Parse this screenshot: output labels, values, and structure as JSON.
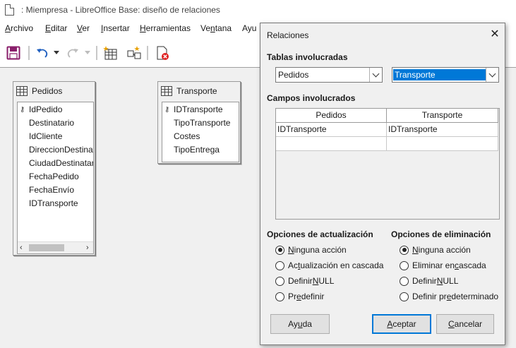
{
  "window": {
    "title": ": Miempresa - LibreOffice Base: diseño de relaciones"
  },
  "menu": [
    {
      "pre": "",
      "u": "A",
      "post": "rchivo"
    },
    {
      "pre": "",
      "u": "E",
      "post": "ditar"
    },
    {
      "pre": "",
      "u": "V",
      "post": "er"
    },
    {
      "pre": "",
      "u": "I",
      "post": "nsertar"
    },
    {
      "pre": "",
      "u": "H",
      "post": "erramientas"
    },
    {
      "pre": "Ve",
      "u": "n",
      "post": "tana"
    },
    {
      "pre": "Ayu",
      "u": "",
      "post": ""
    }
  ],
  "toolbar": {
    "icons": [
      "save-icon",
      "undo-icon",
      "undo-dropdown-icon",
      "redo-icon",
      "redo-dropdown-icon",
      "new-table-icon",
      "new-relation-icon",
      "delete-table-icon"
    ]
  },
  "tables": {
    "pedidos": {
      "name": "Pedidos",
      "fields": [
        "IdPedido",
        "Destinatario",
        "IdCliente",
        "DireccionDestinat",
        "CiudadDestinatar",
        "FechaPedido",
        "FechaEnvío",
        "IDTransporte"
      ],
      "key_field": "IdPedido"
    },
    "transporte": {
      "name": "Transporte",
      "fields": [
        "IDTransporte",
        "TipoTransporte",
        "Costes",
        "TipoEntrega"
      ],
      "key_field": "IDTransporte"
    }
  },
  "dialog": {
    "title": "Relaciones",
    "close_glyph": "✕",
    "tables_label": "Tablas involucradas",
    "table_left": "Pedidos",
    "table_right": "Transporte",
    "fields_label": "Campos involucrados",
    "grid": {
      "headers": [
        "Pedidos",
        "Transporte"
      ],
      "rows": [
        [
          "IDTransporte",
          "IDTransporte"
        ],
        [
          "",
          ""
        ]
      ]
    },
    "update_options": {
      "label": "Opciones de actualización",
      "items": [
        {
          "pre": "",
          "u": "N",
          "post": "inguna acción",
          "selected": true
        },
        {
          "pre": "Ac",
          "u": "t",
          "post": "ualización en cascada",
          "selected": false
        },
        {
          "pre": "Definir ",
          "u": "N",
          "post": "ULL",
          "selected": false
        },
        {
          "pre": "Pr",
          "u": "e",
          "post": "definir",
          "selected": false
        }
      ]
    },
    "delete_options": {
      "label": "Opciones de eliminación",
      "items": [
        {
          "pre": "",
          "u": "N",
          "post": "inguna acción",
          "selected": true
        },
        {
          "pre": "Eliminar en ",
          "u": "c",
          "post": "ascada",
          "selected": false
        },
        {
          "pre": "Definir ",
          "u": "N",
          "post": "ULL",
          "selected": false
        },
        {
          "pre": "Definir pr",
          "u": "e",
          "post": "determinado",
          "selected": false
        }
      ]
    },
    "buttons": {
      "help": {
        "pre": "Ay",
        "u": "u",
        "post": "da"
      },
      "ok": {
        "pre": "",
        "u": "A",
        "post": "ceptar"
      },
      "cancel": {
        "pre": "",
        "u": "C",
        "post": "ancelar"
      }
    }
  },
  "colors": {
    "selection": "#0078d7",
    "dialog_bg": "#f0f0f0",
    "save_icon": "#8a1f6b",
    "undo_icon": "#1f5fbf",
    "delete_icon": "#e02020"
  }
}
